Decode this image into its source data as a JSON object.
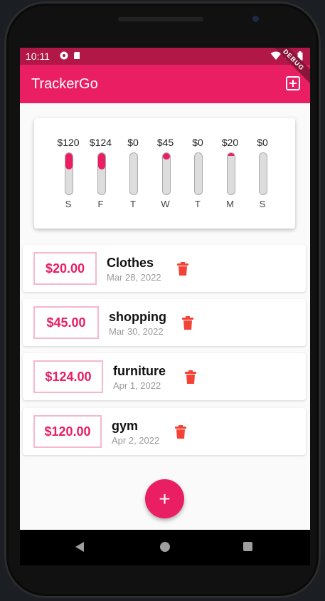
{
  "status_bar": {
    "time": "10:11",
    "icons": [
      "play-protect-icon",
      "sd-card-icon",
      "wifi-icon",
      "cell-signal-icon",
      "battery-icon"
    ]
  },
  "app_bar": {
    "title": "TrackerGo",
    "action_icon": "add-box-icon",
    "debug_banner": "DEBUG"
  },
  "chart_data": {
    "type": "bar",
    "categories": [
      "S",
      "F",
      "T",
      "W",
      "T",
      "M",
      "S"
    ],
    "value_labels": [
      "$120",
      "$124",
      "$0",
      "$45",
      "$0",
      "$20",
      "$0"
    ],
    "values": [
      120,
      124,
      0,
      45,
      0,
      20,
      0
    ],
    "fill_fraction": [
      0.39,
      0.4,
      0,
      0.15,
      0,
      0.06,
      0
    ],
    "fill_color": "#e91e63",
    "track_color": "#dddddd"
  },
  "transactions": [
    {
      "amount": "$20.00",
      "title": "Clothes",
      "date": "Mar 28, 2022"
    },
    {
      "amount": "$45.00",
      "title": "shopping",
      "date": "Mar 30, 2022"
    },
    {
      "amount": "$124.00",
      "title": "furniture",
      "date": "Apr 1, 2022"
    },
    {
      "amount": "$120.00",
      "title": "gym",
      "date": "Apr 2, 2022"
    }
  ],
  "fab": {
    "label": "+",
    "icon": "plus-icon"
  },
  "colors": {
    "primary": "#e91e63",
    "primary_dark": "#b11848",
    "delete": "#f44336"
  },
  "navigation": {
    "icons": [
      "back-icon",
      "home-icon",
      "recents-icon"
    ]
  }
}
